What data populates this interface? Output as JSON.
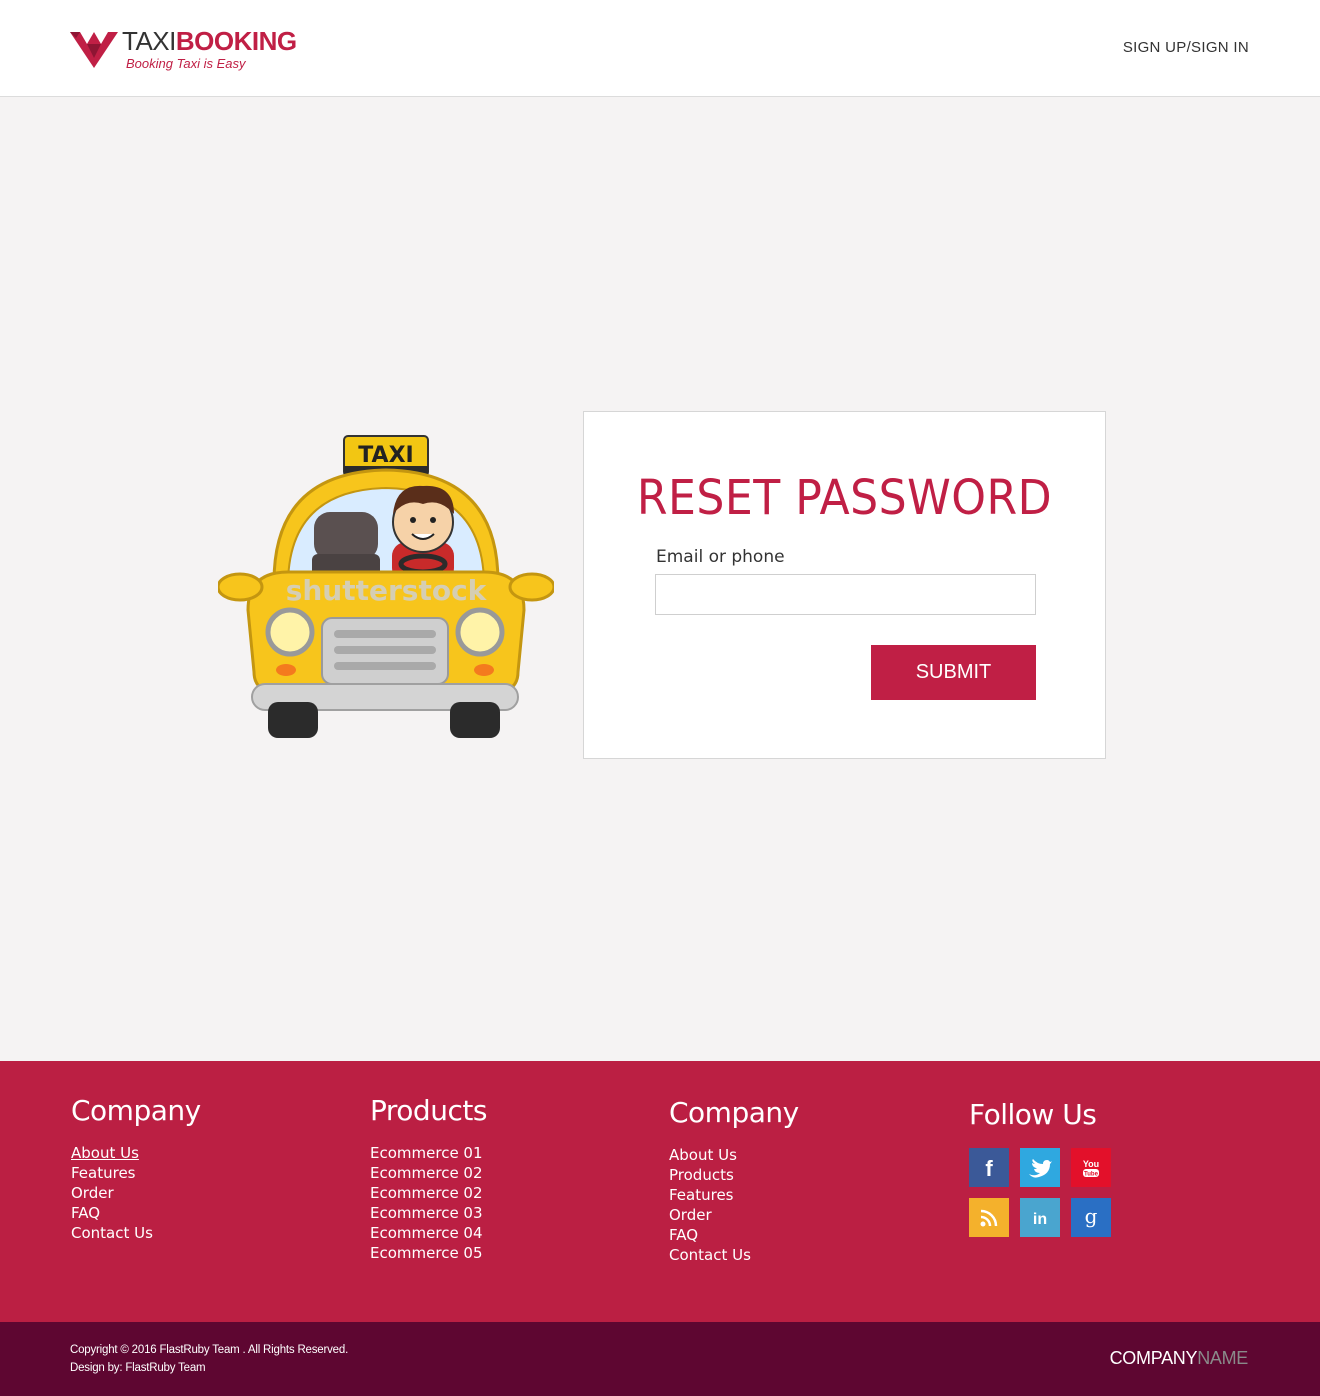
{
  "brand": {
    "name_part1": "TAXI",
    "name_part2": "BOOKING",
    "tagline": "Booking Taxi is Easy",
    "primary_color": "#c01f45",
    "dark_color": "#5e0631"
  },
  "header": {
    "nav_link": "SIGN UP/SIGN IN"
  },
  "illustration": {
    "roof_sign": "TAXI",
    "watermark": "shutterstock"
  },
  "reset": {
    "title": "RESET PASSWORD",
    "field_label": "Email or phone",
    "field_value": "",
    "submit_label": "SUBMIT"
  },
  "footer": {
    "col1": {
      "heading": "Company",
      "links": [
        "About Us",
        "Features",
        "Order",
        "FAQ",
        "Contact Us"
      ]
    },
    "col2": {
      "heading": "Products",
      "links": [
        "Ecommerce 01",
        "Ecommerce 02",
        "Ecommerce 02",
        "Ecommerce 03",
        "Ecommerce 04",
        "Ecommerce 05"
      ]
    },
    "col3": {
      "heading": "Company",
      "links": [
        "About Us",
        "Products",
        "Features",
        "Order",
        "FAQ",
        "Contact Us"
      ]
    },
    "follow": {
      "heading": "Follow Us",
      "icons": [
        {
          "name": "facebook-icon",
          "color": "#3b5998"
        },
        {
          "name": "twitter-icon",
          "color": "#2fa8e0"
        },
        {
          "name": "youtube-icon",
          "color": "#e3102a"
        },
        {
          "name": "rss-icon",
          "color": "#f4b12c"
        },
        {
          "name": "linkedin-icon",
          "color": "#4aa5cf"
        },
        {
          "name": "google-icon",
          "color": "#2a6fc4"
        }
      ]
    }
  },
  "bottom": {
    "copyright_line1": "Copyright ©  2016 FlastRuby Team . All Rights Reserved.",
    "copyright_line2": "Design by: FlastRuby Team",
    "company_part1": "COMPANY",
    "company_part2": "NAME"
  }
}
